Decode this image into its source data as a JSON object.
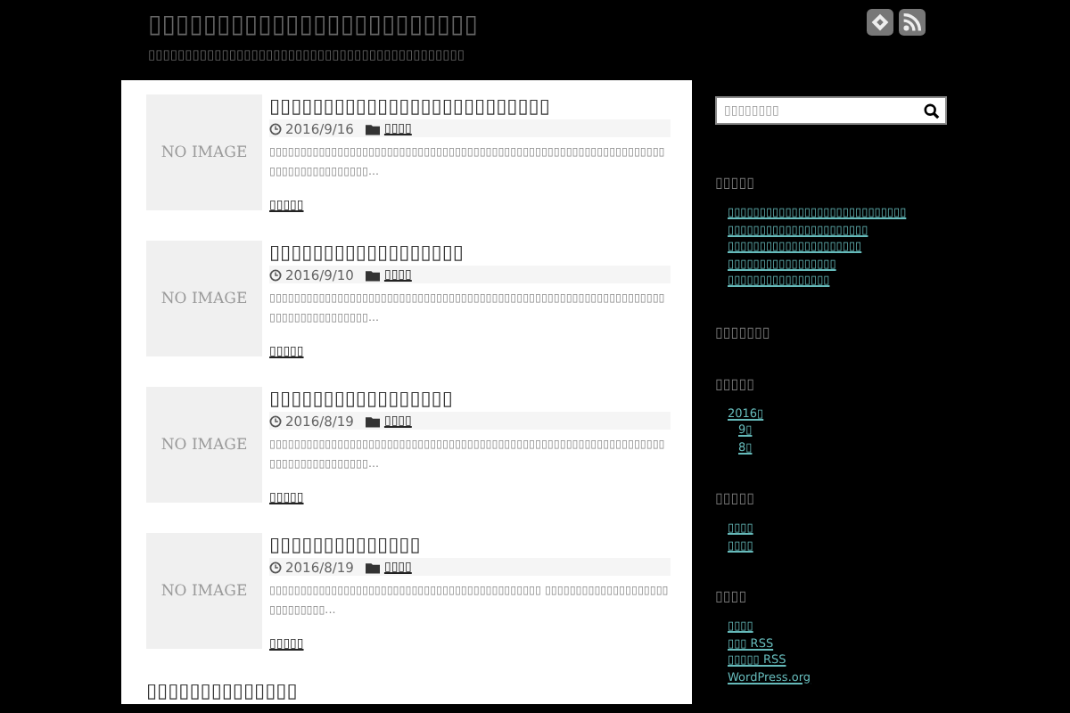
{
  "site": {
    "title": "▯▯▯▯▯▯▯▯▯▯▯▯▯▯▯▯▯▯▯▯▯▯▯▯",
    "tagline": "▯▯▯▯▯▯▯▯▯▯▯▯▯▯▯▯▯▯▯▯▯▯▯▯▯▯▯▯▯▯▯▯▯▯▯▯▯▯▯▯▯▯▯"
  },
  "posts": [
    {
      "thumb": "NO IMAGE",
      "title": "▯▯▯▯▯▯▯▯▯▯▯▯▯▯▯▯▯▯▯▯▯▯▯▯▯▯",
      "date": "2016/9/16",
      "category": "▯▯▯▯",
      "excerpt": "▯▯▯▯▯▯▯▯▯▯▯▯▯▯▯▯▯▯▯▯▯▯▯▯▯▯▯▯▯▯▯▯▯▯▯▯▯▯▯▯▯▯▯▯▯▯▯▯▯▯▯▯▯▯▯▯▯▯▯▯▯▯▯▯▯▯▯▯▯▯▯▯▯▯▯▯▯▯▯▯...",
      "more": "▯▯▯▯▯"
    },
    {
      "thumb": "NO IMAGE",
      "title": "▯▯▯▯▯▯▯▯▯▯▯▯▯▯▯▯▯▯",
      "date": "2016/9/10",
      "category": "▯▯▯▯",
      "excerpt": "▯▯▯▯▯▯▯▯▯▯▯▯▯▯▯▯▯▯▯▯▯▯▯▯▯▯▯▯▯▯▯▯▯▯▯▯▯▯▯▯▯▯▯▯▯▯▯▯▯▯▯▯▯▯▯▯▯▯▯▯▯▯▯▯▯▯▯▯▯▯▯▯▯▯▯▯▯▯▯▯...",
      "more": "▯▯▯▯▯"
    },
    {
      "thumb": "NO IMAGE",
      "title": "▯▯▯▯▯▯▯▯▯▯▯▯▯▯▯▯▯",
      "date": "2016/8/19",
      "category": "▯▯▯▯",
      "excerpt": "▯▯▯▯▯▯▯▯▯▯▯▯▯▯▯▯▯▯▯▯▯▯▯▯▯▯▯▯▯▯▯▯▯▯▯▯▯▯▯▯▯▯▯▯▯▯▯▯▯▯▯▯▯▯▯▯▯▯▯▯▯▯▯▯▯▯▯▯▯▯▯▯▯▯▯▯▯▯▯▯...",
      "more": "▯▯▯▯▯"
    },
    {
      "thumb": "NO IMAGE",
      "title": "▯▯▯▯▯▯▯▯▯▯▯▯▯▯",
      "date": "2016/8/19",
      "category": "▯▯▯▯",
      "excerpt": "▯▯▯▯▯▯▯▯▯▯▯▯▯▯▯▯▯▯▯▯▯▯▯▯▯▯▯▯▯▯▯▯▯▯▯▯▯▯▯▯▯▯▯▯ ▯▯▯▯▯▯▯▯▯▯▯▯▯▯▯▯▯▯▯▯▯▯▯▯▯▯▯▯▯...",
      "more": "▯▯▯▯▯"
    },
    {
      "title": "▯▯▯▯▯▯▯▯▯▯▯▯▯▯"
    }
  ],
  "search": {
    "placeholder": "▯▯▯▯▯▯▯▯"
  },
  "widgets": [
    {
      "kind": "list",
      "title": "▯▯▯▯▯",
      "items": [
        {
          "label": "▯▯▯▯▯▯▯▯▯▯▯▯▯▯▯▯▯▯▯▯▯▯▯▯▯▯▯▯"
        },
        {
          "label": "▯▯▯▯▯▯▯▯▯▯▯▯▯▯▯▯▯▯▯▯▯▯"
        },
        {
          "label": "▯▯▯▯▯▯▯▯▯▯▯▯▯▯▯▯▯▯▯▯▯"
        },
        {
          "label": "▯▯▯▯▯▯▯▯▯▯▯▯▯▯▯▯▯"
        },
        {
          "label": "▯▯▯▯▯▯▯▯▯▯▯▯▯▯▯▯"
        }
      ]
    },
    {
      "title": "▯▯▯▯▯▯▯"
    },
    {
      "kind": "tree",
      "title": "▯▯▯▯▯",
      "items": [
        {
          "label": "2016▯",
          "children": [
            {
              "label": "9▯"
            },
            {
              "label": "8▯"
            }
          ]
        }
      ]
    },
    {
      "kind": "list",
      "title": "▯▯▯▯▯",
      "items": [
        {
          "label": "▯▯▯▯"
        },
        {
          "label": "▯▯▯▯"
        }
      ]
    },
    {
      "kind": "list",
      "title": "▯▯▯▯",
      "items": [
        {
          "label": "▯▯▯▯"
        },
        {
          "label": "▯▯▯ RSS"
        },
        {
          "label": "▯▯▯▯▯ RSS"
        },
        {
          "label": "WordPress.org"
        }
      ]
    }
  ]
}
